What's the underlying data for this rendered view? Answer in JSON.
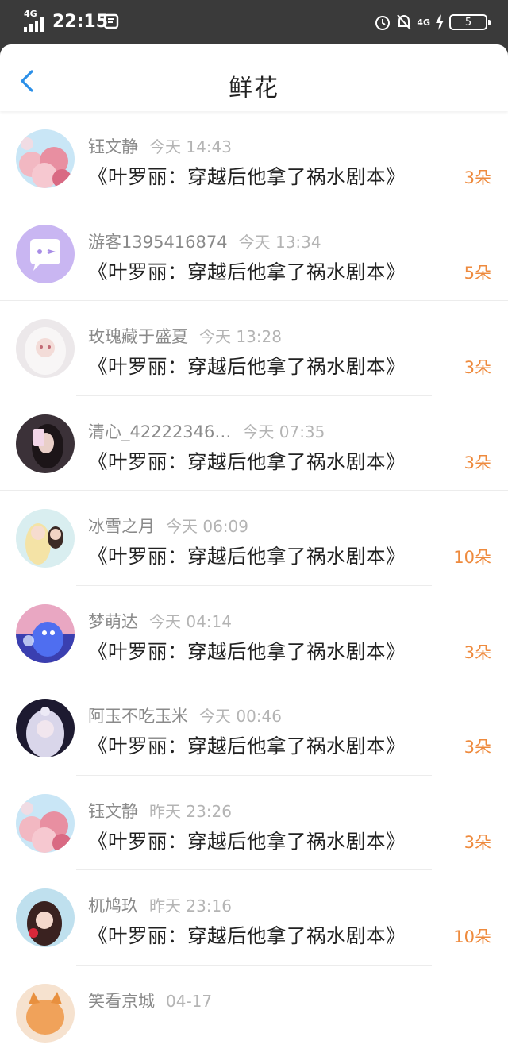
{
  "status_bar": {
    "network": "4G",
    "time": "22:15",
    "network_right": "4G",
    "battery": "5"
  },
  "header": {
    "title": "鲜花"
  },
  "colors": {
    "accent_blue": "#2b8fe8",
    "count_orange": "#ee8a3d"
  },
  "list": [
    {
      "name": "钰文静",
      "time": "今天 14:43",
      "book": "《叶罗丽：穿越后他拿了祸水剧本》",
      "count": "3朵",
      "avatar": "flowers"
    },
    {
      "name": "游客1395416874",
      "time": "今天 13:34",
      "book": "《叶罗丽：穿越后他拿了祸水剧本》",
      "count": "5朵",
      "avatar": "chat-bubble"
    },
    {
      "name": "玫瑰藏于盛夏",
      "time": "今天 13:28",
      "book": "《叶罗丽：穿越后他拿了祸水剧本》",
      "count": "3朵",
      "avatar": "white-hair-girl"
    },
    {
      "name": "清心_42222346…",
      "time": "今天 07:35",
      "book": "《叶罗丽：穿越后他拿了祸水剧本》",
      "count": "3朵",
      "avatar": "dark-girl"
    },
    {
      "name": "冰雪之月",
      "time": "今天 06:09",
      "book": "《叶罗丽：穿越后他拿了祸水剧本》",
      "count": "10朵",
      "avatar": "anime-couple"
    },
    {
      "name": "梦萌达",
      "time": "今天 04:14",
      "book": "《叶罗丽：穿越后他拿了祸水剧本》",
      "count": "3朵",
      "avatar": "blue-dino"
    },
    {
      "name": "阿玉不吃玉米",
      "time": "今天 00:46",
      "book": "《叶罗丽：穿越后他拿了祸水剧本》",
      "count": "3朵",
      "avatar": "silver-girl"
    },
    {
      "name": "钰文静",
      "time": "昨天 23:26",
      "book": "《叶罗丽：穿越后他拿了祸水剧本》",
      "count": "3朵",
      "avatar": "flowers"
    },
    {
      "name": "杌鸠玖",
      "time": "昨天 23:16",
      "book": "《叶罗丽：穿越后他拿了祸水剧本》",
      "count": "10朵",
      "avatar": "red-hair-girl"
    },
    {
      "name": "笑看京城",
      "time": "04-17",
      "book": "",
      "count": "",
      "avatar": "orange-cat"
    }
  ]
}
